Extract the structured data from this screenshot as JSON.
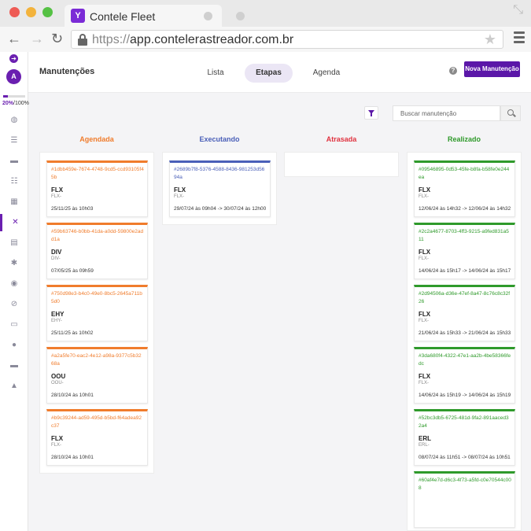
{
  "browser": {
    "tab_title": "Contele Fleet",
    "tab_logo": "Y",
    "url_protocol": "https://",
    "url_host": "app.contelerastreador.com.br"
  },
  "sidebar": {
    "avatar_initial": "A",
    "progress_value": "20%",
    "progress_total": "/100%",
    "progress_fraction": 0.2,
    "items": [
      {
        "icon": "globe-icon",
        "glyph": "◍"
      },
      {
        "icon": "list-icon",
        "glyph": "☰"
      },
      {
        "icon": "car-icon",
        "glyph": "▬"
      },
      {
        "icon": "checklist-icon",
        "glyph": "☷"
      },
      {
        "icon": "grid-icon",
        "glyph": "▦"
      },
      {
        "icon": "tools-icon",
        "glyph": "✕",
        "active": true
      },
      {
        "icon": "document-icon",
        "glyph": "▤"
      },
      {
        "icon": "cog-icon",
        "glyph": "✱"
      },
      {
        "icon": "record-icon",
        "glyph": "◉"
      },
      {
        "icon": "block-icon",
        "glyph": "⊘"
      },
      {
        "icon": "id-card-icon",
        "glyph": "▭"
      },
      {
        "icon": "user-icon",
        "glyph": "●"
      },
      {
        "icon": "vehicle-icon",
        "glyph": "▬"
      },
      {
        "icon": "map-user-icon",
        "glyph": "▲"
      }
    ]
  },
  "header": {
    "title": "Manutenções",
    "tabs": [
      {
        "label": "Lista",
        "active": false
      },
      {
        "label": "Etapas",
        "active": true
      },
      {
        "label": "Agenda",
        "active": false
      }
    ],
    "help_glyph": "?",
    "new_button": "Nova Manutenção"
  },
  "search": {
    "placeholder": "Buscar manutenção"
  },
  "colors": {
    "agendada": "#f07c2c",
    "executando": "#4a5fb8",
    "atrasada": "#e0323f",
    "realizado": "#2f9a2b",
    "brand": "#5b17a8"
  },
  "columns": [
    {
      "title": "Agendada",
      "color": "#f07c2c",
      "cards": [
        {
          "id": "#1dbb459e-7674-4748-9cd5-ccd93105f45b",
          "plate": "FLX",
          "plate_sub": "FLX-",
          "date": "25/11/25 às 10h03"
        },
        {
          "id": "#59b63746-b0bb-41da-a0dd-59800e2add1a",
          "plate": "DIV",
          "plate_sub": "DIV-",
          "date": "07/05/25 às 09h59"
        },
        {
          "id": "#750d98e3-b4c0-49e0-8bc5-2645a711b5d0",
          "plate": "EHY",
          "plate_sub": "EHY-",
          "date": "25/11/25 às 10h02"
        },
        {
          "id": "#a2a5fe70-eac2-4e12-a98a-9377c5b3268a",
          "plate": "OOU",
          "plate_sub": "OOU-",
          "date": "28/10/24 às 10h01"
        },
        {
          "id": "#b9c39244-ad59-495d-b5bd-f64adea92c37",
          "plate": "FLX",
          "plate_sub": "FLX-",
          "date": "28/10/24 às 10h01"
        }
      ]
    },
    {
      "title": "Executando",
      "color": "#4a5fb8",
      "cards": [
        {
          "id": "#2689b7f8-5376-4588-8436-981253d5694a",
          "plate": "FLX",
          "plate_sub": "FLX-",
          "date": "29/07/24 às 09h04 -> 30/07/24 às 12h00"
        }
      ]
    },
    {
      "title": "Atrasada",
      "color": "#e0323f",
      "cards": []
    },
    {
      "title": "Realizado",
      "color": "#2f9a2b",
      "cards": [
        {
          "id": "#09546895-0d53-45fe-b8fa-b58fe0e244ea",
          "plate": "FLX",
          "plate_sub": "FLX-",
          "date": "12/06/24 às 14h32 -> 12/06/24 às 14h32"
        },
        {
          "id": "#2c2a4677-8703-4ff3-9215-a9fed831a511",
          "plate": "FLX",
          "plate_sub": "FLX-",
          "date": "14/06/24 às 15h17 -> 14/06/24 às 15h17"
        },
        {
          "id": "#2d94506a-d36e-47ef-8a47-8c76c8c32f26",
          "plate": "FLX",
          "plate_sub": "FLX-",
          "date": "21/06/24 às 15h33 -> 21/06/24 às 15h33"
        },
        {
          "id": "#3da680f4-4322-47e1-aa2b-4be58366fedc",
          "plate": "FLX",
          "plate_sub": "FLX-",
          "date": "14/06/24 às 15h19 -> 14/06/24 às 15h19"
        },
        {
          "id": "#52bc3db5-6725-481d-9fa2-891aaced32a4",
          "plate": "ERL",
          "plate_sub": "ERL-",
          "date": "08/07/24 às 11h51 -> 08/07/24 às 10h51"
        },
        {
          "id": "#60af4e7d-d6c3-4f73-a5fd-c0e70544c008",
          "plate": "",
          "plate_sub": "",
          "date": ""
        }
      ]
    }
  ]
}
